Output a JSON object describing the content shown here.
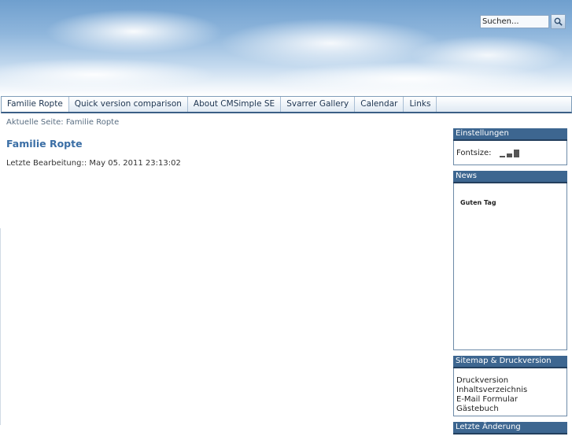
{
  "search": {
    "placeholder": "Suchen..."
  },
  "nav": {
    "items": [
      {
        "label": "Familie Ropte",
        "active": true
      },
      {
        "label": "Quick version comparison"
      },
      {
        "label": "About CMSimple SE"
      },
      {
        "label": "Svarrer Gallery"
      },
      {
        "label": "Calendar"
      },
      {
        "label": "Links"
      }
    ]
  },
  "main": {
    "breadcrumb": "Aktuelle Seite: Familie Ropte",
    "title": "Familie Ropte",
    "last_edit": "Letzte Bearbeitung:: May 05. 2011 23:13:02"
  },
  "sidebar": {
    "settings": {
      "title": "Einstellungen",
      "fontsize_label": "Fontsize:"
    },
    "news": {
      "title": "News",
      "text": "Guten Tag"
    },
    "sitemap": {
      "title": "Sitemap & Druckversion",
      "links": [
        "Druckversion",
        "Inhaltsverzeichnis",
        "E-Mail Formular",
        "Gästebuch"
      ]
    },
    "last_change": {
      "title": "Letzte Änderung"
    }
  }
}
